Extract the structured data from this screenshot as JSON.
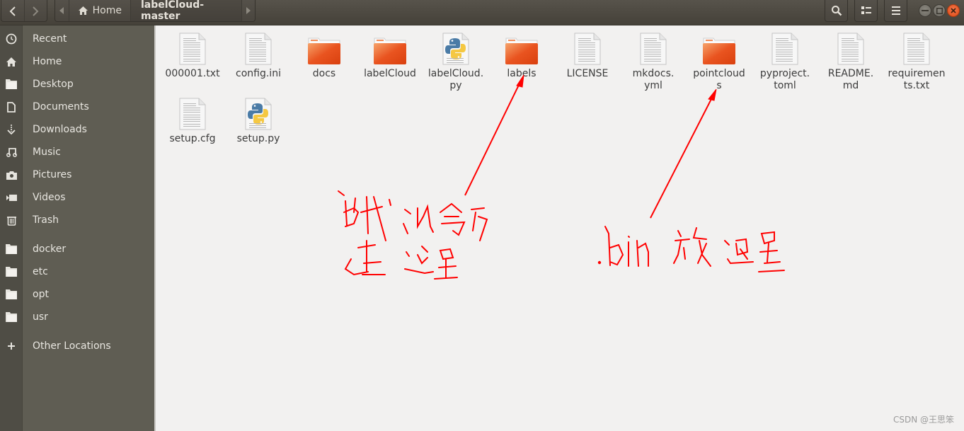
{
  "window": {
    "title": "labelCloud-master"
  },
  "header": {
    "back_label": "Back",
    "forward_label": "Forward",
    "path": [
      {
        "label": "Home",
        "icon": "home-icon"
      },
      {
        "label": "labelCloud-master",
        "current": true
      }
    ],
    "tools": [
      {
        "name": "search",
        "icon": "search-icon"
      },
      {
        "name": "view-toggle",
        "icon": "list-view-icon"
      },
      {
        "name": "menu",
        "icon": "hamburger-menu-icon"
      }
    ],
    "window_controls": [
      "minimize",
      "maximize",
      "close"
    ]
  },
  "sidebar": {
    "items": [
      {
        "label": "Recent",
        "icon": "clock-icon"
      },
      {
        "label": "Home",
        "icon": "home-icon"
      },
      {
        "label": "Desktop",
        "icon": "folder-icon"
      },
      {
        "label": "Documents",
        "icon": "document-icon"
      },
      {
        "label": "Downloads",
        "icon": "download-icon"
      },
      {
        "label": "Music",
        "icon": "music-icon"
      },
      {
        "label": "Pictures",
        "icon": "camera-icon"
      },
      {
        "label": "Videos",
        "icon": "video-icon"
      },
      {
        "label": "Trash",
        "icon": "trash-icon"
      }
    ],
    "bookmarks": [
      {
        "label": "docker",
        "icon": "folder-icon"
      },
      {
        "label": "etc",
        "icon": "folder-icon"
      },
      {
        "label": "opt",
        "icon": "folder-icon"
      },
      {
        "label": "usr",
        "icon": "folder-icon"
      }
    ],
    "other_locations": {
      "label": "Other Locations",
      "icon": "plus-icon"
    }
  },
  "files": [
    {
      "name": "000001.txt",
      "type": "text"
    },
    {
      "name": "config.ini",
      "type": "text"
    },
    {
      "name": "docs",
      "type": "folder"
    },
    {
      "name": "labelCloud",
      "type": "folder"
    },
    {
      "name": "labelCloud.\npy",
      "type": "python"
    },
    {
      "name": "labels",
      "type": "folder"
    },
    {
      "name": "LICENSE",
      "type": "text"
    },
    {
      "name": "mkdocs.\nyml",
      "type": "text"
    },
    {
      "name": "pointcloud\ns",
      "type": "folder"
    },
    {
      "name": "pyproject.\ntoml",
      "type": "text"
    },
    {
      "name": "README.\nmd",
      "type": "text"
    },
    {
      "name": "requiremen\nts.txt",
      "type": "text"
    },
    {
      "name": "setup.cfg",
      "type": "text"
    },
    {
      "name": "setup.py",
      "type": "python"
    }
  ],
  "annotations": {
    "color": "#ff0000",
    "note_labels": "生成的会存在这里",
    "note_pointclouds": ".bin 放这里",
    "arrow_targets": [
      "labels",
      "pointclouds"
    ]
  },
  "watermark": "CSDN @王思笨",
  "colors": {
    "folder": "#e95420",
    "sidebar_bg": "#5f5d53",
    "header_bg": "#4d4943",
    "content_bg": "#f2f1f0",
    "close_button": "#e4571f"
  }
}
